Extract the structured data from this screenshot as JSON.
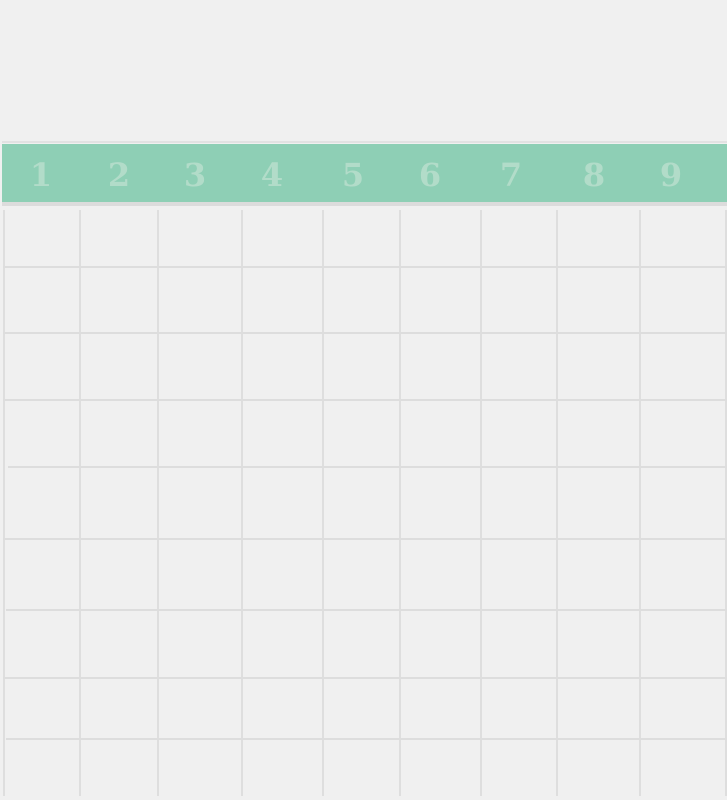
{
  "grid": {
    "columns": [
      "1",
      "2",
      "3",
      "4",
      "5",
      "6",
      "7",
      "8",
      "9"
    ],
    "row_count": 9
  },
  "colors": {
    "header_band": "#8ecfb5",
    "header_label": "#b2dcc9",
    "background": "#f0f0f0",
    "grid_line": "#dddddd"
  }
}
